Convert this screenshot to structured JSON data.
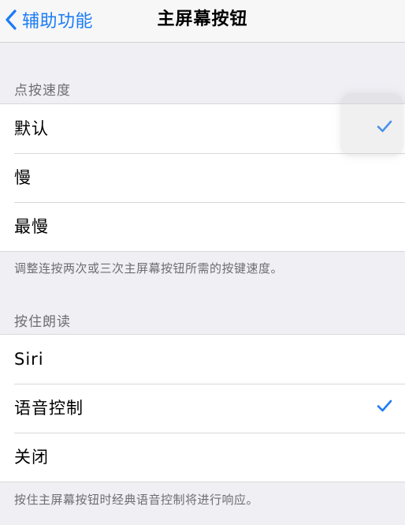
{
  "nav": {
    "back_label": "辅助功能",
    "title": "主屏幕按钮"
  },
  "sections": [
    {
      "header": "点按速度",
      "rows": [
        {
          "label": "默认",
          "checked": true
        },
        {
          "label": "慢",
          "checked": false
        },
        {
          "label": "最慢",
          "checked": false
        }
      ],
      "footer": "调整连按两次或三次主屏幕按钮所需的按键速度。"
    },
    {
      "header": "按住朗读",
      "rows": [
        {
          "label": "Siri",
          "checked": false
        },
        {
          "label": "语音控制",
          "checked": true
        },
        {
          "label": "关闭",
          "checked": false
        }
      ],
      "footer": "按住主屏幕按钮时经典语音控制将进行响应。"
    }
  ],
  "colors": {
    "accent": "#1a7cf5",
    "background": "#efeff4"
  },
  "icons": {
    "back": "chevron-left-icon",
    "check": "checkmark-icon"
  }
}
